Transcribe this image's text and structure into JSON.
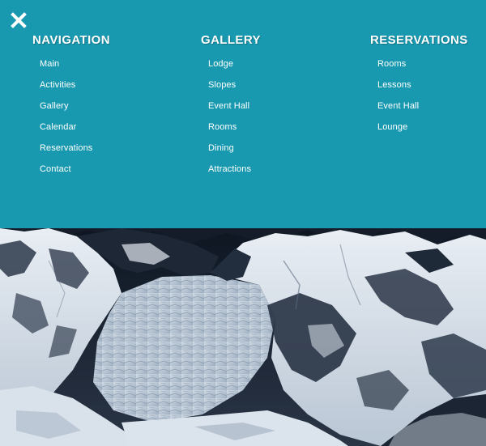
{
  "close": {
    "icon": "close-icon"
  },
  "menu": {
    "background": "#1999b0",
    "columns": [
      {
        "heading": "NAVIGATION",
        "items": [
          "Main",
          "Activities",
          "Gallery",
          "Calendar",
          "Reservations",
          "Contact"
        ]
      },
      {
        "heading": "GALLERY",
        "items": [
          "Lodge",
          "Slopes",
          "Event Hall",
          "Rooms",
          "Dining",
          "Attractions"
        ]
      },
      {
        "heading": "RESERVATIONS",
        "items": [
          "Rooms",
          "Lessons",
          "Event Hall",
          "Lounge"
        ]
      }
    ]
  }
}
